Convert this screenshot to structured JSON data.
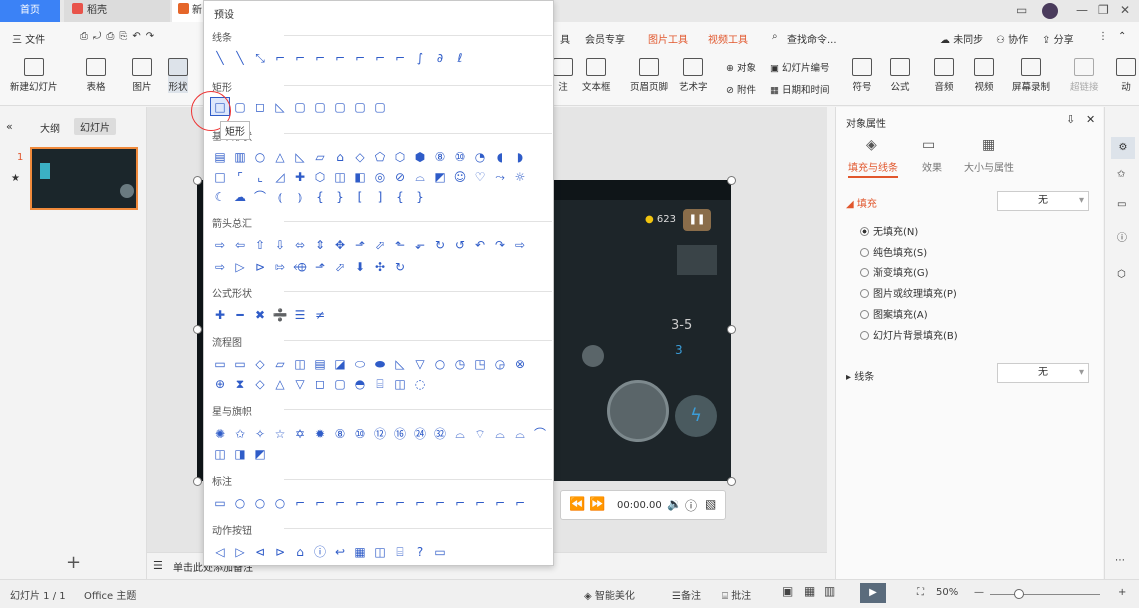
{
  "tabs": {
    "home": "首页",
    "doc": "稻壳",
    "file": "新"
  },
  "menu": {
    "file": "三 文件",
    "exclusive": "会员专享",
    "pic_tools": "图片工具",
    "video_tools": "视频工具",
    "search": "查找命令...",
    "sync": "未同步",
    "collab": "协作",
    "share": "分享",
    "partial": "具"
  },
  "ribbon": {
    "new_slide": "新建幻灯片",
    "table": "表格",
    "picture": "图片",
    "shape": "形状",
    "annot": "注",
    "textbox": "文本框",
    "header_footer": "页眉页脚",
    "art": "艺术字",
    "object": "对象",
    "slide_number": "幻灯片编号",
    "attach": "附件",
    "datetime": "日期和时间",
    "symbol": "符号",
    "formula": "公式",
    "audio": "音频",
    "video": "视频",
    "screenrec": "屏幕录制",
    "hyperlink": "超链接",
    "anim": "动"
  },
  "left": {
    "outline": "大纲",
    "slides": "幻灯片",
    "slide_num": "1"
  },
  "notes": "单击此处添加备注",
  "player": {
    "time": "00:00.00"
  },
  "game": {
    "coins": "623",
    "level": "3-5",
    "icon": "3"
  },
  "right": {
    "title": "对象属性",
    "tab_fill": "填充与线条",
    "tab_effect": "效果",
    "tab_size": "大小与属性",
    "fill": "填充",
    "fill_value": "无",
    "line": "线条",
    "line_value": "无",
    "options": [
      "无填充(N)",
      "纯色填充(S)",
      "渐变填充(G)",
      "图片或纹理填充(P)",
      "图案填充(A)",
      "幻灯片背景填充(B)"
    ]
  },
  "status": {
    "slide": "幻灯片 1 / 1",
    "theme": "Office 主题",
    "beautify": "智能美化",
    "notes": "备注",
    "comment": "批注",
    "zoom": "50%"
  },
  "dropdown": {
    "title": "预设",
    "sections": [
      "线条",
      "矩形",
      "基本形状",
      "箭头总汇",
      "公式形状",
      "流程图",
      "星与旗帜",
      "标注",
      "动作按钮"
    ],
    "tooltip": "矩形"
  },
  "shapes": {
    "lines": "╲╲⤡⌐⌐⌐⌐⌐⌐⌐∫∂ℓ",
    "rect": "□▢◻◺▢▢▢▢▢",
    "basic1": "▤▥○△◺▱⌂◇⬠⬡⬢⑧⑩◔◖◗",
    "basic2": "□⌜⌞◿✚⬡◫◧◎⊘⌓◩☺♡⤳☼",
    "basic3": "☾☁⌒⦅⦆{}[]{}",
    "arrow1": "⇨⇦⇧⇩⬄⇕✥⬏⬀⬑⬐↻↺↶↷⇨",
    "arrow2": "⇨▷⊳⇰⬲⬏⬀⬇✣↻",
    "formula": "✚━✖➗☰≠",
    "flow1": "▭▭◇▱◫▤◪⬭⬬◺▽○◷◳◶⊗",
    "flow2": "⊕⧗◇△▽◻▢◓⌸◫◌",
    "star1": "✺✩✧☆✡✹⑧⑩⑫⑯㉔㉜⌓⌔⌓⌓⌒",
    "star2": "◫◨◩",
    "callout": "▭○○○⌐⌐⌐⌐⌐⌐⌐⌐⌐⌐⌐⌐",
    "action": "◁▷⊲⊳⌂ⓘ↩▦◫⌸?▭"
  }
}
